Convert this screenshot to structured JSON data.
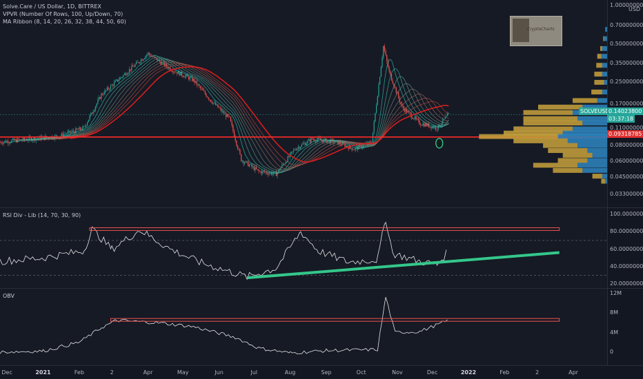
{
  "colors": {
    "bull": "#26a69a",
    "bear": "#ef5350",
    "ribbon_fast": "#2ea3ff",
    "ribbon_slow": "#d81e1e",
    "support": "#ff2a2a",
    "vp_up": "#2e86c1",
    "vp_down": "#c8a23c",
    "rsi_trend": "#34c78b",
    "line_white": "#e6e6e6",
    "highlight_circle": "#3fd98a"
  },
  "panes": {
    "main": {
      "legend": [
        "Solve.Care / US Dollar, 1D, BITTREX",
        "VPVR (Number Of Rows, 100, Up/Down, 70)",
        "MA Ribbon (8, 14, 20, 26, 32, 38, 44, 50, 60)"
      ],
      "axis_unit": "USD",
      "axis_ticks": [
        "1.00000000",
        "0.70000000",
        "0.50000000",
        "0.35000000",
        "0.25000000",
        "0.17000000",
        "0.11000000",
        "0.08000000",
        "0.06000000",
        "0.04500000",
        "0.03300000"
      ],
      "price_badge": {
        "symbol": "SOLVEUSD",
        "price": "0.14023800",
        "countdown": "03:37:18"
      },
      "support_label": "0.09318785",
      "logo_text": "CryptoCharts"
    },
    "rsi": {
      "legend": "RSI Div - Lib (14, 70, 30, 90)",
      "axis_ticks": [
        "100.00000000",
        "80.00000000",
        "60.00000000",
        "40.00000000",
        "20.00000000"
      ]
    },
    "obv": {
      "legend": "OBV",
      "axis_ticks": [
        "12M",
        "8M",
        "4M",
        "0"
      ]
    },
    "x_axis": [
      "Dec",
      "2021",
      "Feb",
      "2",
      "Apr",
      "May",
      "Jun",
      "Jul",
      "Aug",
      "Sep",
      "Oct",
      "Nov",
      "Dec",
      "2022",
      "Feb",
      "2",
      "Apr"
    ]
  },
  "chart_data": [
    {
      "type": "candlestick",
      "title": "Solve.Care / US Dollar, 1D, BITTREX",
      "yscale": "log",
      "ylim": [
        0.03,
        1.0
      ],
      "x_range": [
        "2020-11-25",
        "2022-04-30"
      ],
      "series_close_approx": [
        {
          "x": "2020-11-25",
          "y": 0.085
        },
        {
          "x": "2020-12-20",
          "y": 0.09
        },
        {
          "x": "2021-01-15",
          "y": 0.095
        },
        {
          "x": "2021-02-05",
          "y": 0.11
        },
        {
          "x": "2021-02-20",
          "y": 0.2
        },
        {
          "x": "2021-03-10",
          "y": 0.28
        },
        {
          "x": "2021-04-01",
          "y": 0.42
        },
        {
          "x": "2021-04-20",
          "y": 0.32
        },
        {
          "x": "2021-05-10",
          "y": 0.26
        },
        {
          "x": "2021-05-25",
          "y": 0.18
        },
        {
          "x": "2021-06-10",
          "y": 0.13
        },
        {
          "x": "2021-06-20",
          "y": 0.062
        },
        {
          "x": "2021-07-05",
          "y": 0.05
        },
        {
          "x": "2021-07-20",
          "y": 0.048
        },
        {
          "x": "2021-08-05",
          "y": 0.075
        },
        {
          "x": "2021-08-20",
          "y": 0.09
        },
        {
          "x": "2021-09-10",
          "y": 0.085
        },
        {
          "x": "2021-09-25",
          "y": 0.075
        },
        {
          "x": "2021-10-10",
          "y": 0.085
        },
        {
          "x": "2021-10-20",
          "y": 0.48
        },
        {
          "x": "2021-10-25",
          "y": 0.3
        },
        {
          "x": "2021-11-05",
          "y": 0.16
        },
        {
          "x": "2021-11-20",
          "y": 0.12
        },
        {
          "x": "2021-12-05",
          "y": 0.11
        },
        {
          "x": "2021-12-15",
          "y": 0.14
        }
      ],
      "annotations": [
        {
          "type": "hline",
          "y": 0.09318785,
          "label": "0.09318785"
        }
      ]
    },
    {
      "type": "line",
      "title": "RSI Div - Lib (14, 70, 30, 90)",
      "ylim": [
        20,
        100
      ],
      "levels": [
        70,
        30
      ],
      "resistance_level": 83,
      "series": [
        {
          "values": [
            [
              "2020-11-25",
              46
            ],
            [
              "2021-01-01",
              50
            ],
            [
              "2021-02-05",
              58
            ],
            [
              "2021-02-12",
              83
            ],
            [
              "2021-03-01",
              60
            ],
            [
              "2021-03-25",
              82
            ],
            [
              "2021-04-20",
              60
            ],
            [
              "2021-05-15",
              45
            ],
            [
              "2021-06-15",
              32
            ],
            [
              "2021-06-25",
              28
            ],
            [
              "2021-07-20",
              38
            ],
            [
              "2021-08-10",
              80
            ],
            [
              "2021-08-25",
              58
            ],
            [
              "2021-09-20",
              45
            ],
            [
              "2021-10-15",
              48
            ],
            [
              "2021-10-22",
              95
            ],
            [
              "2021-10-28",
              55
            ],
            [
              "2021-11-20",
              46
            ],
            [
              "2021-12-05",
              42
            ],
            [
              "2021-12-15",
              58
            ]
          ]
        }
      ],
      "trendline": [
        [
          "2021-06-25",
          27
        ],
        [
          "2022-03-20",
          56
        ]
      ]
    },
    {
      "type": "line",
      "title": "OBV",
      "ylim": [
        -2000000,
        12000000
      ],
      "resistance_level": 6600000,
      "series": [
        {
          "values": [
            [
              "2020-11-25",
              0
            ],
            [
              "2021-01-01",
              200000
            ],
            [
              "2021-02-01",
              2000000
            ],
            [
              "2021-02-20",
              5000000
            ],
            [
              "2021-03-05",
              6500000
            ],
            [
              "2021-04-10",
              6000000
            ],
            [
              "2021-05-10",
              5200000
            ],
            [
              "2021-06-15",
              3000000
            ],
            [
              "2021-07-05",
              800000
            ],
            [
              "2021-08-01",
              -200000
            ],
            [
              "2021-09-01",
              300000
            ],
            [
              "2021-10-15",
              500000
            ],
            [
              "2021-10-22",
              11300000
            ],
            [
              "2021-10-30",
              4000000
            ],
            [
              "2021-11-20",
              4200000
            ],
            [
              "2021-12-15",
              6500000
            ]
          ]
        }
      ]
    }
  ]
}
